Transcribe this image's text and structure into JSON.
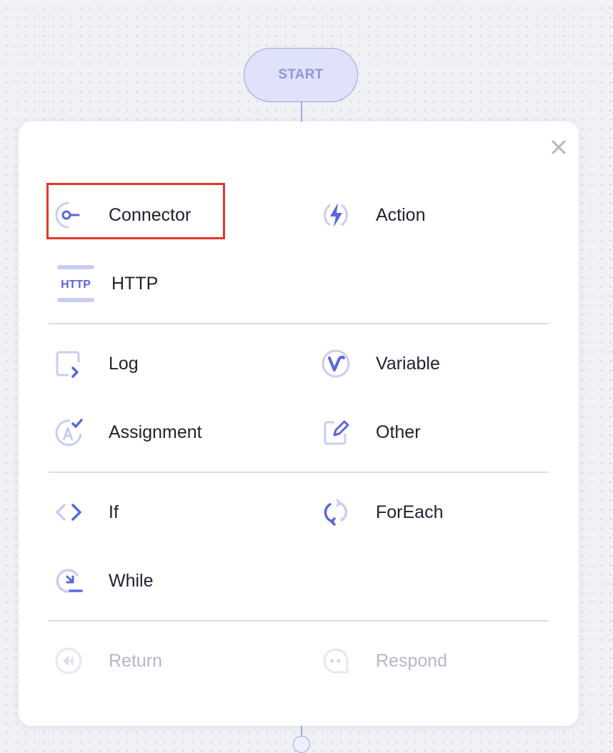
{
  "canvas": {
    "start_label": "START"
  },
  "panel": {
    "close_icon": "close-icon",
    "sections": [
      [
        {
          "label": "Connector",
          "icon": "connector-icon"
        },
        {
          "label": "Action",
          "icon": "lightning-icon"
        },
        {
          "label": "HTTP",
          "icon": "http-icon",
          "icon_text": "HTTP"
        }
      ],
      [
        {
          "label": "Log",
          "icon": "log-icon"
        },
        {
          "label": "Variable",
          "icon": "variable-icon"
        },
        {
          "label": "Assignment",
          "icon": "assignment-icon"
        },
        {
          "label": "Other",
          "icon": "edit-icon"
        }
      ],
      [
        {
          "label": "If",
          "icon": "code-brackets-icon"
        },
        {
          "label": "ForEach",
          "icon": "loop-icon"
        },
        {
          "label": "While",
          "icon": "while-icon"
        }
      ],
      [
        {
          "label": "Return",
          "icon": "return-icon",
          "disabled": true
        },
        {
          "label": "Respond",
          "icon": "chat-bubble-icon",
          "disabled": true
        }
      ]
    ]
  },
  "colors": {
    "accent": "#5a68d6",
    "accent_light": "#c9cdf1",
    "highlight": "#e1382b"
  }
}
